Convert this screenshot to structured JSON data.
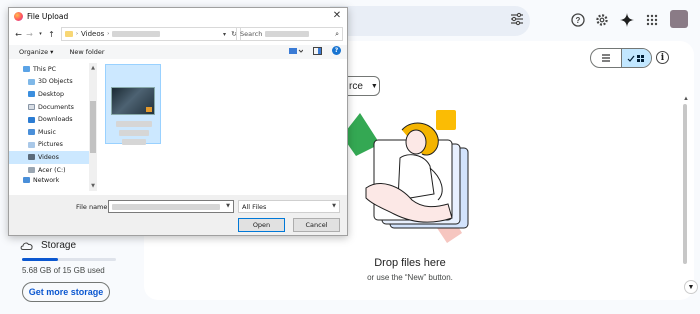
{
  "drive": {
    "filter_chip_label": "rce",
    "drop_title": "Drop files here",
    "drop_subtitle": "or use the “New” button.",
    "storage": {
      "label": "Storage",
      "used_text": "5.68 GB of 15 GB used",
      "used_fraction": 0.38,
      "button_label": "Get more storage"
    },
    "colors": {
      "accent": "#0b57d0",
      "active_toggle": "#c2e7ff"
    }
  },
  "dialog": {
    "title": "File Upload",
    "address": {
      "folder": "Videos"
    },
    "search_placeholder": "Search",
    "toolbar": {
      "organize": "Organize ▾",
      "new_folder": "New folder"
    },
    "tree": [
      {
        "label": "This PC",
        "icon": "computer-icon"
      },
      {
        "label": "3D Objects",
        "icon": "cube-icon"
      },
      {
        "label": "Desktop",
        "icon": "desktop-icon"
      },
      {
        "label": "Documents",
        "icon": "document-icon"
      },
      {
        "label": "Downloads",
        "icon": "download-icon"
      },
      {
        "label": "Music",
        "icon": "music-icon"
      },
      {
        "label": "Pictures",
        "icon": "picture-icon"
      },
      {
        "label": "Videos",
        "icon": "video-icon"
      },
      {
        "label": "Acer (C:)",
        "icon": "drive-icon"
      },
      {
        "label": "Network",
        "icon": "network-icon"
      }
    ],
    "file_name_label": "File name:",
    "file_type": "All Files",
    "open_label": "Open",
    "cancel_label": "Cancel"
  }
}
